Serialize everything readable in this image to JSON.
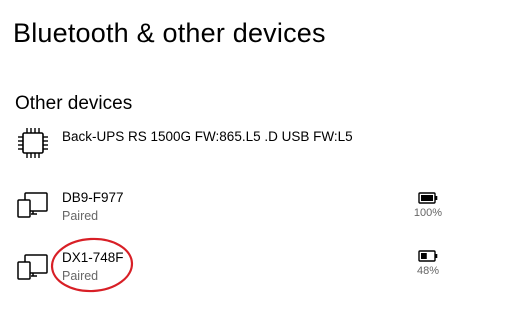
{
  "page": {
    "title": "Bluetooth & other devices"
  },
  "section": {
    "title": "Other devices"
  },
  "devices": [
    {
      "name": "Back-UPS RS 1500G FW:865.L5 .D USB FW:L5",
      "status": "",
      "icon": "chip-icon",
      "battery": null
    },
    {
      "name": "DB9-F977",
      "status": "Paired",
      "icon": "device-icon",
      "battery": {
        "level": 1.0,
        "text": "100%"
      }
    },
    {
      "name": "DX1-748F",
      "status": "Paired",
      "icon": "device-icon",
      "battery": {
        "level": 0.48,
        "text": "48%"
      }
    }
  ],
  "colors": {
    "text": "#000000",
    "secondary_text": "#666666",
    "annotation": "#d81f26"
  }
}
